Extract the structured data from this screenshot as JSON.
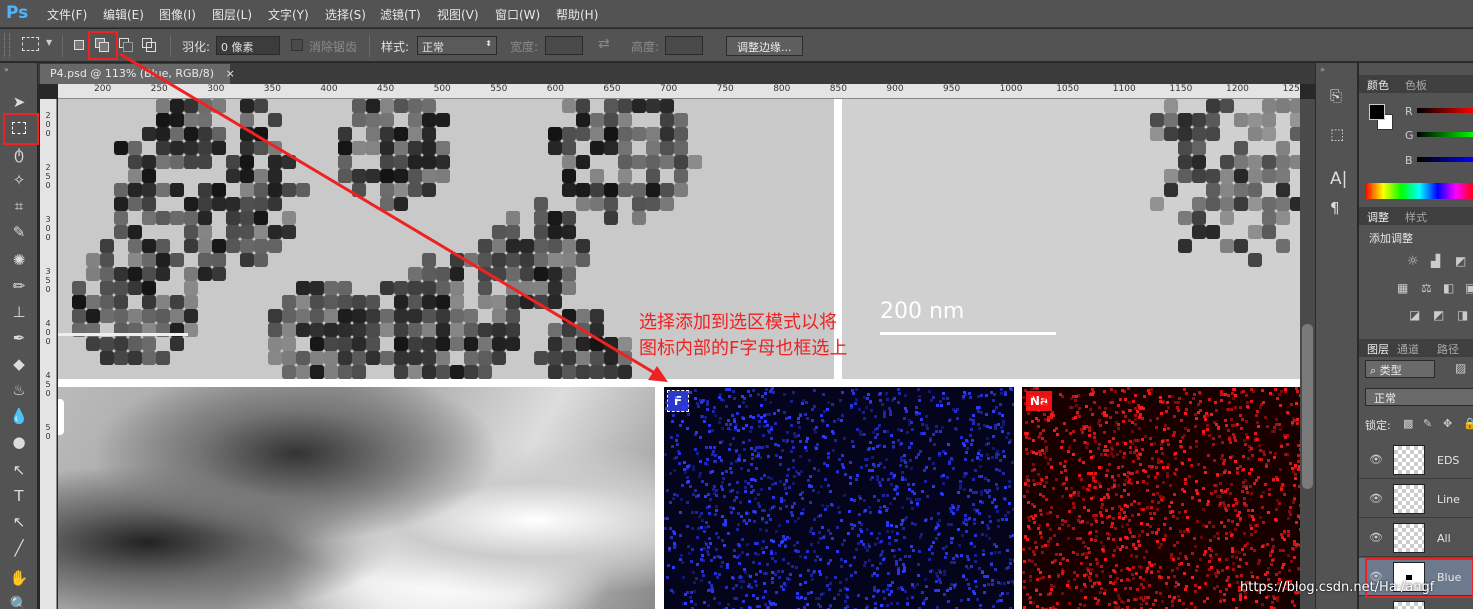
{
  "app": {
    "name": "Ps"
  },
  "menu": [
    "文件(F)",
    "编辑(E)",
    "图像(I)",
    "图层(L)",
    "文字(Y)",
    "选择(S)",
    "滤镜(T)",
    "视图(V)",
    "窗口(W)",
    "帮助(H)"
  ],
  "options": {
    "feather_label": "羽化:",
    "feather_value": "0 像素",
    "antialias_label": "消除锯齿",
    "style_label": "样式:",
    "style_value": "正常",
    "width_label": "宽度:",
    "height_label": "高度:",
    "refine_button": "调整边缘..."
  },
  "document": {
    "tab_title": "P4.psd @ 113% (Blue, RGB/8)",
    "close": "×",
    "ruler_h": [
      "200",
      "250",
      "300",
      "350",
      "400",
      "450",
      "500",
      "550",
      "600",
      "650",
      "700",
      "750",
      "800",
      "850",
      "900",
      "950",
      "1000",
      "1050",
      "1100",
      "1150",
      "1200",
      "125"
    ],
    "ruler_v": [
      "2",
      "0",
      "0",
      "2",
      "5",
      "0",
      "3",
      "0",
      "0",
      "3",
      "5",
      "0",
      "4",
      "0",
      "0",
      "4",
      "5",
      "0",
      "5",
      "0"
    ],
    "scale_label": "200 nm",
    "labels": {
      "f": "F",
      "na": "Na"
    }
  },
  "annotation": {
    "line1": "选择添加到选区模式以将",
    "line2": "图标内部的F字母也框选上",
    "color": "#ee2222"
  },
  "panels": {
    "color": {
      "tabs": [
        "颜色",
        "色板"
      ],
      "channels": [
        "R",
        "G",
        "B"
      ]
    },
    "adjust": {
      "tabs": [
        "调整",
        "样式"
      ],
      "title": "添加调整"
    },
    "layers": {
      "tabs": [
        "图层",
        "通道",
        "路径"
      ],
      "filter_label": "类型",
      "blend_mode": "正常",
      "lock_label": "锁定:",
      "items": [
        {
          "name": "EDS",
          "selected": false
        },
        {
          "name": "Line",
          "selected": false
        },
        {
          "name": "All",
          "selected": false
        },
        {
          "name": "Blue",
          "selected": true
        }
      ]
    }
  },
  "watermark": "https://blog.csdn.net/Ha·/angf",
  "colors": {
    "accent": "#4fb3ff",
    "highlight": "#ee2222",
    "bg": "#535353"
  }
}
